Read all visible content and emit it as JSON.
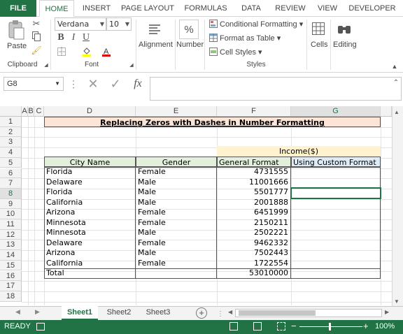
{
  "ribbon_tabs": [
    "FILE",
    "HOME",
    "INSERT",
    "PAGE LAYOUT",
    "FORMULAS",
    "DATA",
    "REVIEW",
    "VIEW",
    "DEVELOPER"
  ],
  "active_tab": "HOME",
  "clipboard": {
    "paste": "Paste",
    "label": "Clipboard"
  },
  "font": {
    "name": "Verdana",
    "size": "10",
    "label": "Font",
    "bold": "B",
    "italic": "I",
    "underline": "U"
  },
  "alignment": {
    "label": "Alignment"
  },
  "number": {
    "label": "Number",
    "symbol": "%"
  },
  "styles": {
    "conditional": "Conditional Formatting",
    "format_table": "Format as Table",
    "cell_styles": "Cell Styles",
    "label": "Styles"
  },
  "cells": {
    "label": "Cells"
  },
  "editing": {
    "label": "Editing"
  },
  "formula_bar": {
    "name_box": "G8",
    "formula": "",
    "fx": "fx"
  },
  "columns": [
    "A",
    "B",
    "C",
    "D",
    "E",
    "F",
    "G"
  ],
  "rows": [
    "1",
    "2",
    "3",
    "4",
    "5",
    "6",
    "7",
    "8",
    "9",
    "10",
    "11",
    "12",
    "13",
    "14",
    "15",
    "16",
    "17",
    "18"
  ],
  "sheet": {
    "title": "Replacing Zeros with Dashes in Number Formatting",
    "income_header": "Income($)",
    "headers": [
      "City Name",
      "Gender",
      "General Format",
      "Using Custom Format"
    ],
    "data": [
      {
        "city": "Florida",
        "gender": "Female",
        "income": "4731555"
      },
      {
        "city": "Delaware",
        "gender": "Male",
        "income": "11001666"
      },
      {
        "city": "Florida",
        "gender": "Male",
        "income": "5501777"
      },
      {
        "city": "California",
        "gender": "Male",
        "income": "2001888"
      },
      {
        "city": "Arizona",
        "gender": "Female",
        "income": "6451999"
      },
      {
        "city": "Minnesota",
        "gender": "Female",
        "income": "2150211"
      },
      {
        "city": "Minnesota",
        "gender": "Male",
        "income": "2502221"
      },
      {
        "city": "Delaware",
        "gender": "Female",
        "income": "9462332"
      },
      {
        "city": "Arizona",
        "gender": "Male",
        "income": "7502443"
      },
      {
        "city": "California",
        "gender": "Female",
        "income": "1722554"
      }
    ],
    "total_label": "Total",
    "total_value": "53010000"
  },
  "sheet_tabs": [
    "Sheet1",
    "Sheet2",
    "Sheet3"
  ],
  "active_sheet": "Sheet1",
  "status": {
    "ready": "READY",
    "zoom": "100%"
  },
  "colors": {
    "excel_green": "#217346",
    "title_fill": "#fce4d6",
    "income_fill": "#fff2cc",
    "header_fill": "#e2efda",
    "custom_fill": "#ddebf7"
  }
}
